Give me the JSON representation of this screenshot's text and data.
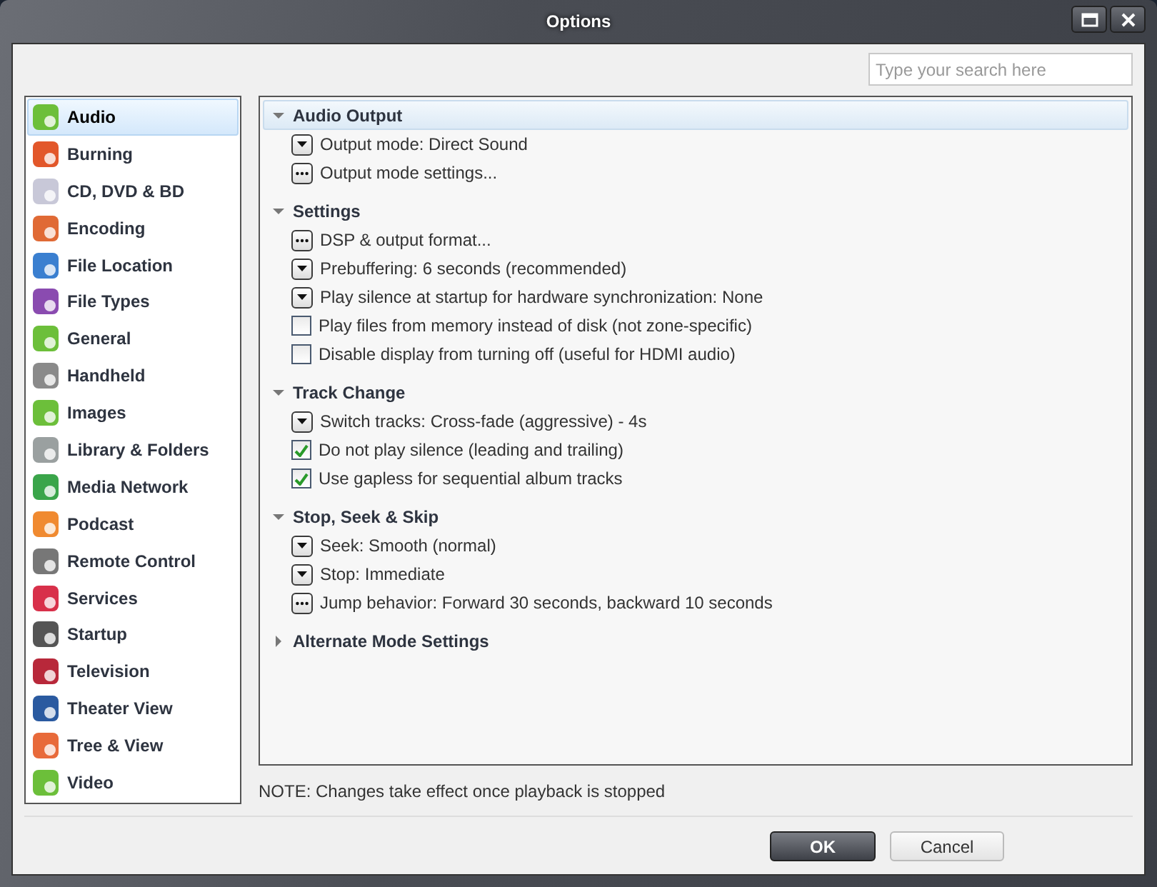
{
  "window": {
    "title": "Options"
  },
  "search": {
    "placeholder": "Type your search here"
  },
  "sidebar": {
    "items": [
      {
        "label": "Audio",
        "selected": true
      },
      {
        "label": "Burning",
        "selected": false
      },
      {
        "label": "CD, DVD & BD",
        "selected": false
      },
      {
        "label": "Encoding",
        "selected": false
      },
      {
        "label": "File Location",
        "selected": false
      },
      {
        "label": "File Types",
        "selected": false
      },
      {
        "label": "General",
        "selected": false
      },
      {
        "label": "Handheld",
        "selected": false
      },
      {
        "label": "Images",
        "selected": false
      },
      {
        "label": "Library & Folders",
        "selected": false
      },
      {
        "label": "Media Network",
        "selected": false
      },
      {
        "label": "Podcast",
        "selected": false
      },
      {
        "label": "Remote Control",
        "selected": false
      },
      {
        "label": "Services",
        "selected": false
      },
      {
        "label": "Startup",
        "selected": false
      },
      {
        "label": "Television",
        "selected": false
      },
      {
        "label": "Theater View",
        "selected": false
      },
      {
        "label": "Tree & View",
        "selected": false
      },
      {
        "label": "Video",
        "selected": false
      }
    ]
  },
  "sections": [
    {
      "title": "Audio Output",
      "expanded": true,
      "highlighted": true,
      "items": [
        {
          "kind": "dropdown",
          "label": "Output mode: Direct Sound"
        },
        {
          "kind": "button",
          "label": "Output mode settings..."
        }
      ]
    },
    {
      "title": "Settings",
      "expanded": true,
      "highlighted": false,
      "items": [
        {
          "kind": "button",
          "label": "DSP & output format..."
        },
        {
          "kind": "dropdown",
          "label": "Prebuffering: 6 seconds (recommended)"
        },
        {
          "kind": "dropdown",
          "label": "Play silence at startup for hardware synchronization: None"
        },
        {
          "kind": "checkbox",
          "label": "Play files from memory instead of disk (not zone-specific)",
          "checked": false
        },
        {
          "kind": "checkbox",
          "label": "Disable display from turning off (useful for HDMI audio)",
          "checked": false
        }
      ]
    },
    {
      "title": "Track Change",
      "expanded": true,
      "highlighted": false,
      "items": [
        {
          "kind": "dropdown",
          "label": "Switch tracks: Cross-fade (aggressive) - 4s"
        },
        {
          "kind": "checkbox",
          "label": "Do not play silence (leading and trailing)",
          "checked": true
        },
        {
          "kind": "checkbox",
          "label": "Use gapless for sequential album tracks",
          "checked": true
        }
      ]
    },
    {
      "title": "Stop, Seek & Skip",
      "expanded": true,
      "highlighted": false,
      "items": [
        {
          "kind": "dropdown",
          "label": "Seek: Smooth (normal)"
        },
        {
          "kind": "dropdown",
          "label": "Stop: Immediate"
        },
        {
          "kind": "button",
          "label": "Jump behavior: Forward 30 seconds, backward 10 seconds"
        }
      ]
    },
    {
      "title": "Alternate Mode Settings",
      "expanded": false,
      "highlighted": false
    }
  ],
  "note": "NOTE: Changes take effect once playback is stopped",
  "buttons": [
    {
      "label": "OK",
      "kind": "primary"
    },
    {
      "label": "Cancel",
      "kind": "secondary"
    }
  ]
}
